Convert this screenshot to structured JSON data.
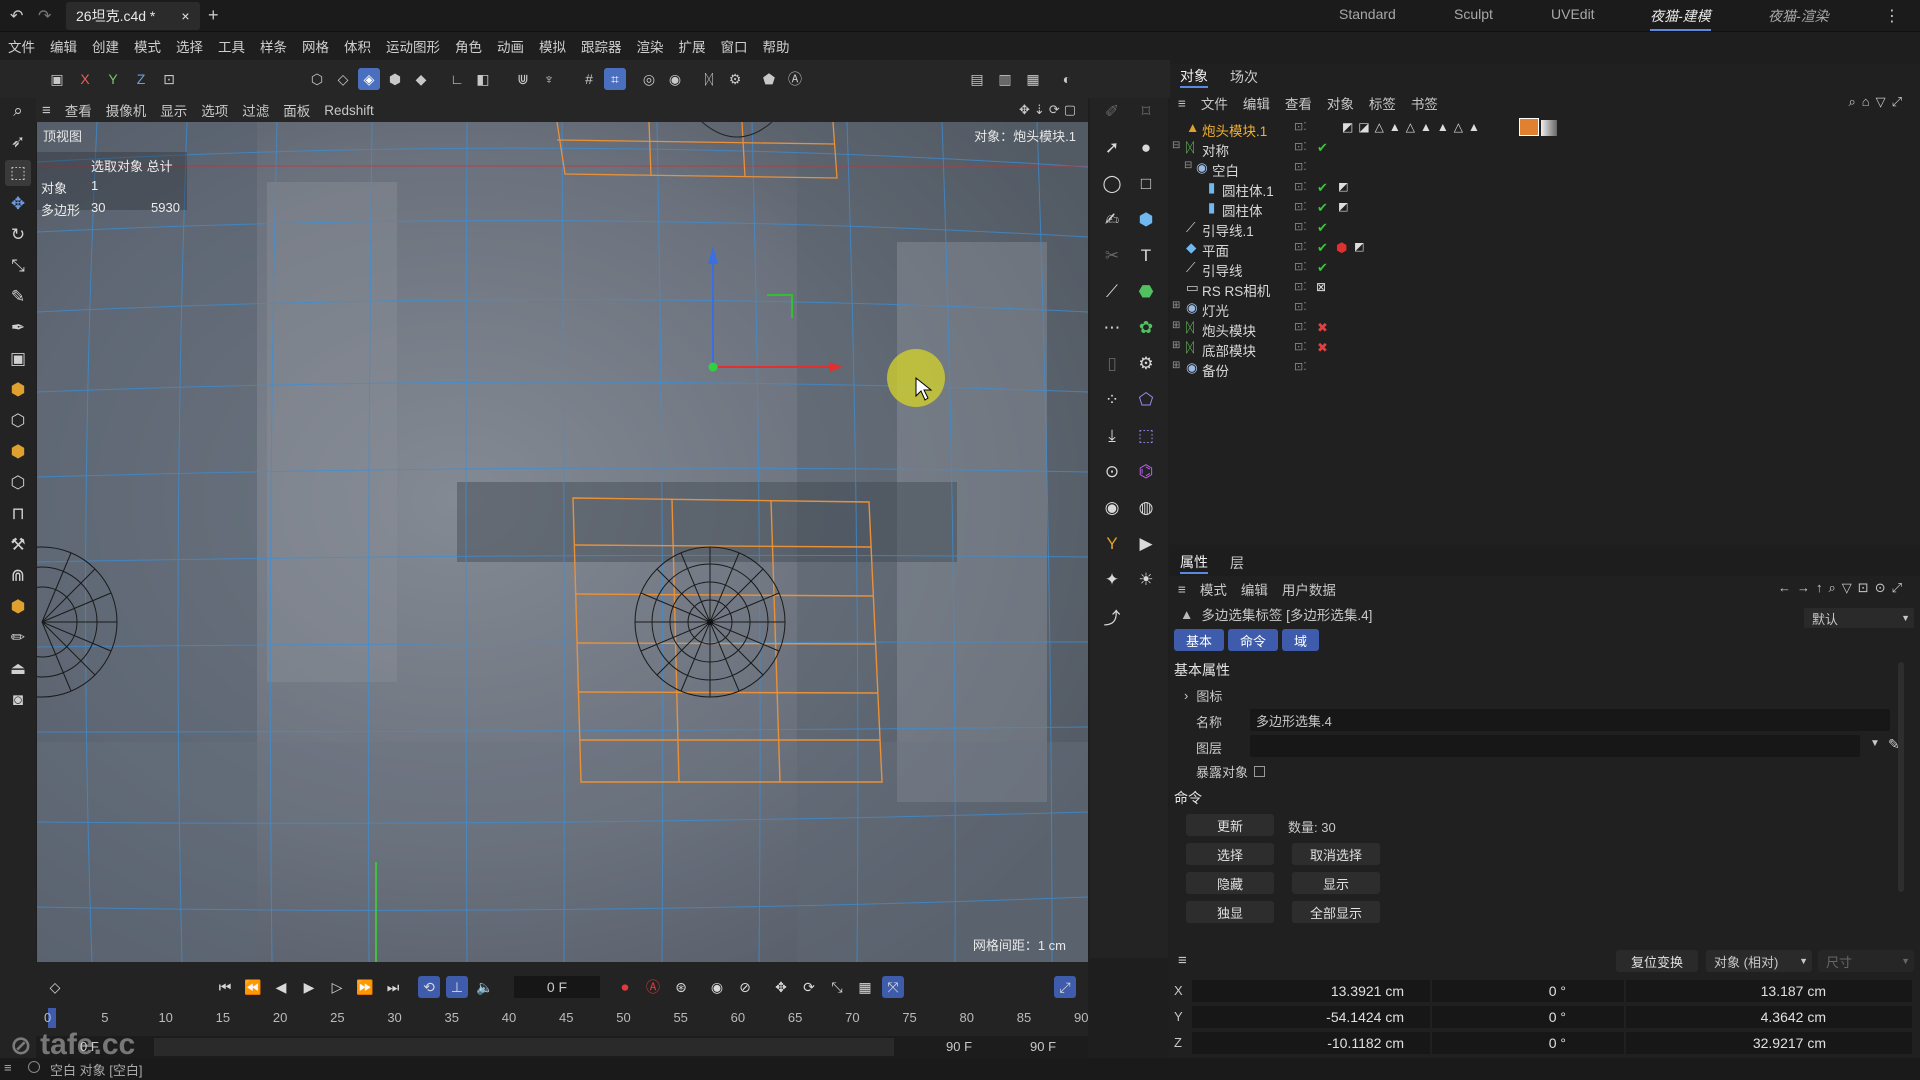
{
  "titlebar": {
    "doc_tab": "26坦克.c4d *",
    "close": "×",
    "add": "+",
    "layouts": [
      "Standard",
      "Sculpt",
      "UVEdit",
      "夜猫-建模",
      "夜猫-渲染"
    ]
  },
  "menubar": [
    "文件",
    "编辑",
    "创建",
    "模式",
    "选择",
    "工具",
    "样条",
    "网格",
    "体积",
    "运动图形",
    "角色",
    "动画",
    "模拟",
    "跟踪器",
    "渲染",
    "扩展",
    "窗口",
    "帮助"
  ],
  "toolbar": {
    "axes": [
      "X",
      "Y",
      "Z"
    ]
  },
  "viewport_menu": [
    "查看",
    "摄像机",
    "显示",
    "选项",
    "过滤",
    "面板",
    "Redshift"
  ],
  "viewport": {
    "view_name": "顶视图",
    "stats_header": "选取对象 总计",
    "stats": [
      {
        "label": "对象",
        "selected": "1",
        "total": ""
      },
      {
        "label": "多边形",
        "selected": "30",
        "total": "5930"
      }
    ],
    "object_label": "对象：炮头模块.1",
    "grid_spacing": "网格间距：1 cm"
  },
  "objects_panel": {
    "tabs": [
      "对象",
      "场次"
    ],
    "menu": [
      "文件",
      "编辑",
      "查看",
      "对象",
      "标签",
      "书签"
    ],
    "rows": [
      {
        "name": "炮头模块.1",
        "indent": 0,
        "highlight": true,
        "status": ""
      },
      {
        "name": "对称",
        "indent": 0,
        "highlight": false,
        "status": "check"
      },
      {
        "name": "空白",
        "indent": 1,
        "highlight": false,
        "status": ""
      },
      {
        "name": "圆柱体.1",
        "indent": 2,
        "highlight": false,
        "status": "check"
      },
      {
        "name": "圆柱体",
        "indent": 2,
        "highlight": false,
        "status": "check"
      },
      {
        "name": "引导线.1",
        "indent": 0,
        "highlight": false,
        "status": "check"
      },
      {
        "name": "平面",
        "indent": 0,
        "highlight": false,
        "status": "check"
      },
      {
        "name": "引导线",
        "indent": 0,
        "highlight": false,
        "status": "check"
      },
      {
        "name": "RS RS相机",
        "indent": 0,
        "highlight": false,
        "status": ""
      },
      {
        "name": "灯光",
        "indent": 0,
        "highlight": false,
        "status": ""
      },
      {
        "name": "炮头模块",
        "indent": 0,
        "highlight": false,
        "status": "x"
      },
      {
        "name": "底部模块",
        "indent": 0,
        "highlight": false,
        "status": "x"
      },
      {
        "name": "备份",
        "indent": 0,
        "highlight": false,
        "status": ""
      }
    ]
  },
  "attributes_panel": {
    "tabs": [
      "属性",
      "层"
    ],
    "menu": [
      "模式",
      "编辑",
      "用户数据"
    ],
    "title": "多边选集标签 [多边形选集.4]",
    "preset": "默认",
    "subtabs": [
      "基本",
      "命令",
      "域"
    ],
    "section_basic": "基本属性",
    "icon_label": "图标",
    "name_label": "名称",
    "name_value": "多边形选集.4",
    "layer_label": "图层",
    "expose_label": "暴露对象",
    "section_command": "命令",
    "update_btn": "更新",
    "count_text": "数量: 30",
    "select_btn": "选择",
    "deselect_btn": "取消选择",
    "hide_btn": "隐藏",
    "show_btn": "显示",
    "isolate_btn": "独显",
    "show_all_btn": "全部显示"
  },
  "coordinates": {
    "reset_btn": "复位变换",
    "mode": "对象 (相对)",
    "size_label": "尺寸",
    "rows": [
      {
        "axis": "X",
        "pos": "13.3921 cm",
        "rot": "0 °",
        "size": "13.187 cm"
      },
      {
        "axis": "Y",
        "pos": "-54.1424 cm",
        "rot": "0 °",
        "size": "4.3642 cm"
      },
      {
        "axis": "Z",
        "pos": "-10.1182 cm",
        "rot": "0 °",
        "size": "32.9217 cm"
      }
    ]
  },
  "timeline": {
    "current_frame": "0 F",
    "ticks": [
      "0",
      "5",
      "10",
      "15",
      "20",
      "25",
      "30",
      "35",
      "40",
      "45",
      "50",
      "55",
      "60",
      "65",
      "70",
      "75",
      "80",
      "85",
      "90"
    ],
    "start": "0 F",
    "start2": "0 F",
    "end": "90 F",
    "end2": "90 F"
  },
  "status": "空白 对象 [空白]",
  "watermark": "tafe.cc"
}
